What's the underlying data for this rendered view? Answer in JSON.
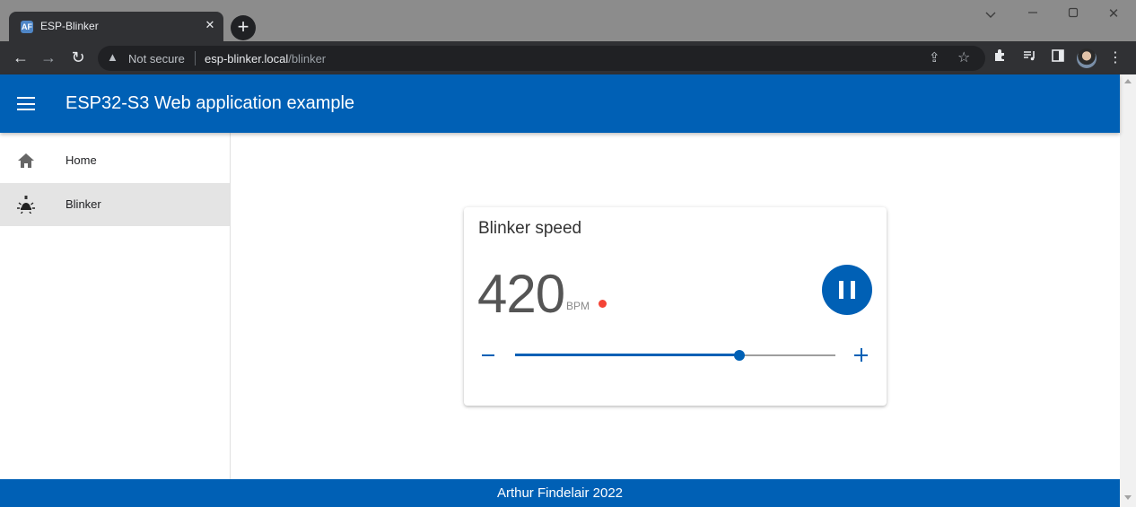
{
  "browser": {
    "tab_title": "ESP-Blinker",
    "favicon_label": "AF",
    "security_label": "Not secure",
    "url_host": "esp-blinker.local",
    "url_path": "/blinker"
  },
  "app": {
    "title": "ESP32-S3 Web application example",
    "accent_color": "#0060b5"
  },
  "sidebar": {
    "items": [
      {
        "label": "Home",
        "icon": "home-icon",
        "selected": false
      },
      {
        "label": "Blinker",
        "icon": "bulb-icon",
        "selected": true
      }
    ]
  },
  "card": {
    "title": "Blinker speed",
    "value": "420",
    "unit": "BPM",
    "status_color": "#f44336",
    "slider_fraction": 0.7
  },
  "footer": {
    "text": "Arthur Findelair 2022"
  }
}
